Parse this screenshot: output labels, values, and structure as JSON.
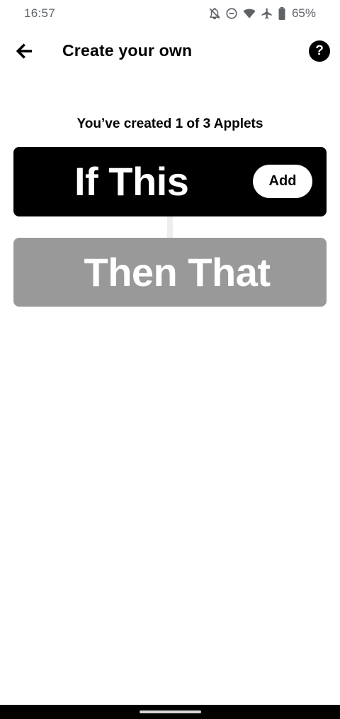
{
  "status_bar": {
    "time": "16:57",
    "battery_percent": "65%",
    "icons": [
      "notifications-off-icon",
      "do-not-disturb-icon",
      "wifi-icon",
      "airplane-mode-icon",
      "battery-icon"
    ]
  },
  "header": {
    "title": "Create your own",
    "back_icon": "arrow-left-icon",
    "help_label": "?"
  },
  "main": {
    "applet_count": "You’ve created 1 of 3 Applets",
    "if_this": {
      "label": "If This",
      "add_label": "Add",
      "background": "#000000"
    },
    "then_that": {
      "label": "Then That",
      "background": "#999999"
    }
  }
}
